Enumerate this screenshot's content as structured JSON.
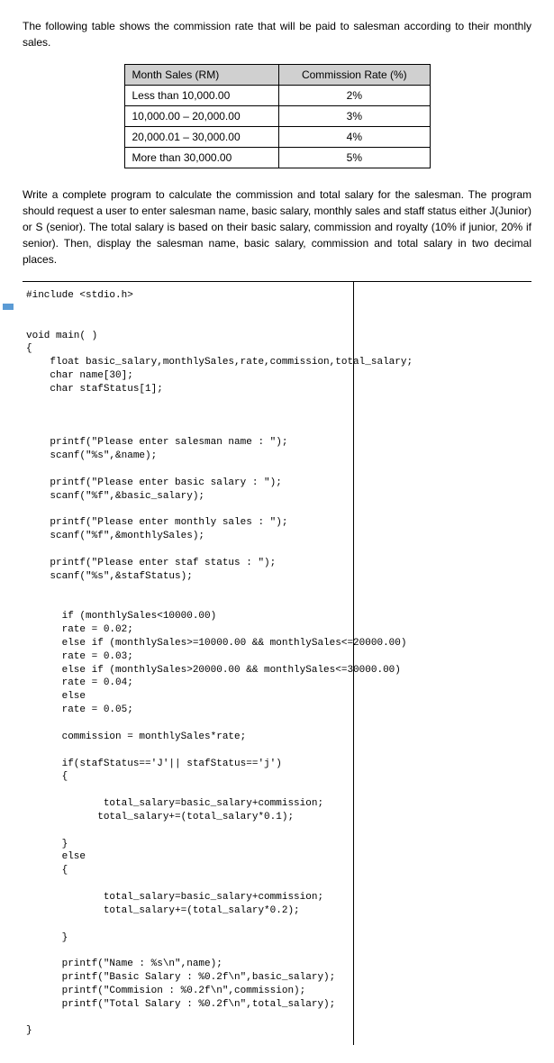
{
  "intro": "The following table shows the commission rate that will be paid to salesman according to their monthly sales.",
  "table": {
    "headers": {
      "sales": "Month Sales (RM)",
      "rate": "Commission Rate (%)"
    },
    "rows": [
      {
        "sales": "Less than 10,000.00",
        "rate": "2%"
      },
      {
        "sales": "10,000.00 – 20,000.00",
        "rate": "3%"
      },
      {
        "sales": "20,000.01 – 30,000.00",
        "rate": "4%"
      },
      {
        "sales": "More than 30,000.00",
        "rate": "5%"
      }
    ]
  },
  "problem": "Write a complete program to calculate the commission and total salary for the salesman. The program should request a user to enter salesman name, basic salary, monthly sales and staff status either J(Junior) or S (senior). The total salary is based on their basic salary, commission and royalty (10% if junior, 20% if senior). Then, display the salesman name, basic salary, commission and total salary in two decimal places.",
  "code": "#include <stdio.h>\n\n\nvoid main( )\n{\n    float basic_salary,monthlySales,rate,commission,total_salary;\n    char name[30];\n    char stafStatus[1];\n\n\n\n    printf(\"Please enter salesman name : \");\n    scanf(\"%s\",&name);\n\n    printf(\"Please enter basic salary : \");\n    scanf(\"%f\",&basic_salary);\n\n    printf(\"Please enter monthly sales : \");\n    scanf(\"%f\",&monthlySales);\n\n    printf(\"Please enter staf status : \");\n    scanf(\"%s\",&stafStatus);\n\n\n      if (monthlySales<10000.00)\n      rate = 0.02;\n      else if (monthlySales>=10000.00 && monthlySales<=20000.00)\n      rate = 0.03;\n      else if (monthlySales>20000.00 && monthlySales<=30000.00)\n      rate = 0.04;\n      else\n      rate = 0.05;\n\n      commission = monthlySales*rate;\n\n      if(stafStatus=='J'|| stafStatus=='j')\n      {\n\n             total_salary=basic_salary+commission;\n            total_salary+=(total_salary*0.1);\n\n      }\n      else\n      {\n\n             total_salary=basic_salary+commission;\n             total_salary+=(total_salary*0.2);\n\n      }\n\n      printf(\"Name : %s\\n\",name);\n      printf(\"Basic Salary : %0.2f\\n\",basic_salary);\n      printf(\"Commision : %0.2f\\n\",commission);\n      printf(\"Total Salary : %0.2f\\n\",total_salary);\n\n}"
}
